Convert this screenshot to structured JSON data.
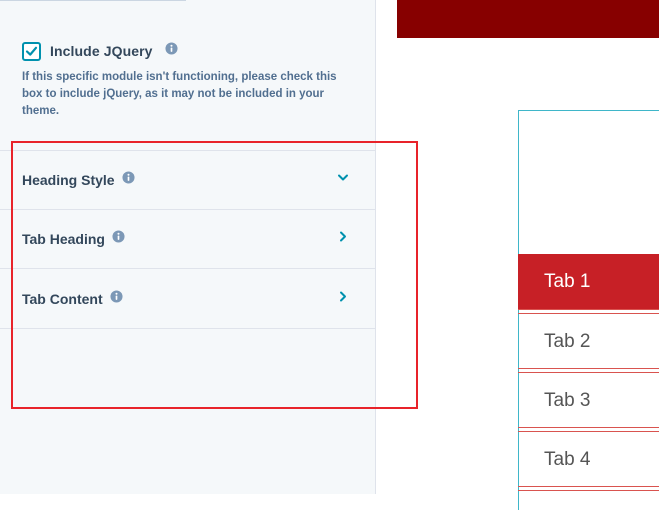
{
  "include_jquery": {
    "label": "Include JQuery",
    "checked": true,
    "help": "If this specific module isn't functioning, please check this box to include jQuery, as it may not be included in your theme."
  },
  "accordion": [
    {
      "label": "Heading Style",
      "expanded": true,
      "chevron": "chevron-down-icon"
    },
    {
      "label": "Tab Heading",
      "expanded": false,
      "chevron": "chevron-right-icon"
    },
    {
      "label": "Tab Content",
      "expanded": false,
      "chevron": "chevron-right-icon"
    }
  ],
  "preview": {
    "tabs": [
      "Tab 1",
      "Tab 2",
      "Tab 3",
      "Tab 4"
    ],
    "active_tab": 0
  },
  "colors": {
    "accent": "#0091ae",
    "banner": "#870000",
    "active_tab": "#c72026",
    "highlight": "#e8232a"
  }
}
